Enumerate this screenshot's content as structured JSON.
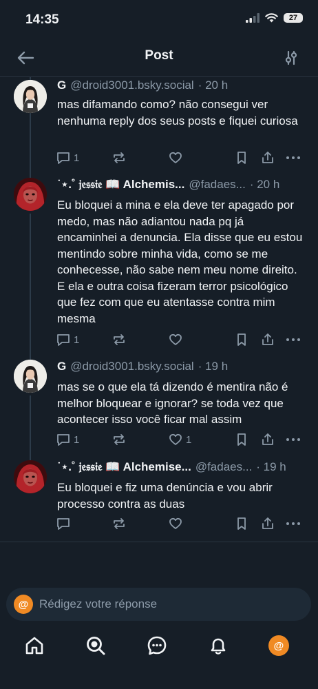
{
  "status_bar": {
    "time": "14:35",
    "battery": "27"
  },
  "header": {
    "title": "Post",
    "back_icon": "arrow-left-icon",
    "filter_icon": "sliders-icon"
  },
  "posts": [
    {
      "name": "G",
      "handle": "@droid3001.bsky.social",
      "time": "· 20 h",
      "text": "mas difamando como? não consegui ver nenhuma reply dos seus posts e fiquei curiosa",
      "replies": "1",
      "reposts": "",
      "likes": ""
    },
    {
      "name": "˙⋆.˚ 𝔧𝔢𝔰𝔰𝔦𝔢 📖 Alchemis...",
      "handle": "@fadaes...",
      "time": "· 20 h",
      "text": "Eu bloquei a mina e ela deve ter apagado por medo, mas não adiantou nada pq já encaminhei a denuncia. Ela disse que eu estou mentindo sobre minha vida, como se me conhecesse, não sabe nem meu nome direito. E ela e outra coisa fizeram terror psicológico que fez com que eu atentasse contra mim mesma",
      "replies": "1",
      "reposts": "",
      "likes": ""
    },
    {
      "name": "G",
      "handle": "@droid3001.bsky.social",
      "time": "· 19 h",
      "text": "mas se o que ela tá dizendo é mentira não é melhor bloquear e ignorar? se toda vez que acontecer isso você ficar mal assim",
      "replies": "1",
      "reposts": "",
      "likes": "1"
    },
    {
      "name": "˙⋆.˚ 𝔧𝔢𝔰𝔰𝔦𝔢 📖 Alchemise...",
      "handle": "@fadaes...",
      "time": "· 19 h",
      "text": "Eu bloquei e fiz uma denúncia e vou abrir processo contra as duas",
      "replies": "",
      "reposts": "",
      "likes": ""
    }
  ],
  "composer": {
    "placeholder": "Rédigez votre réponse",
    "avatar_glyph": "@"
  },
  "tabbar": {
    "items": [
      "home-icon",
      "search-icon",
      "chat-icon",
      "bell-icon",
      "profile-avatar"
    ],
    "avatar_glyph": "@"
  },
  "colors": {
    "background": "#161e27",
    "muted": "#8c9aa8",
    "accent": "#f08a24"
  }
}
